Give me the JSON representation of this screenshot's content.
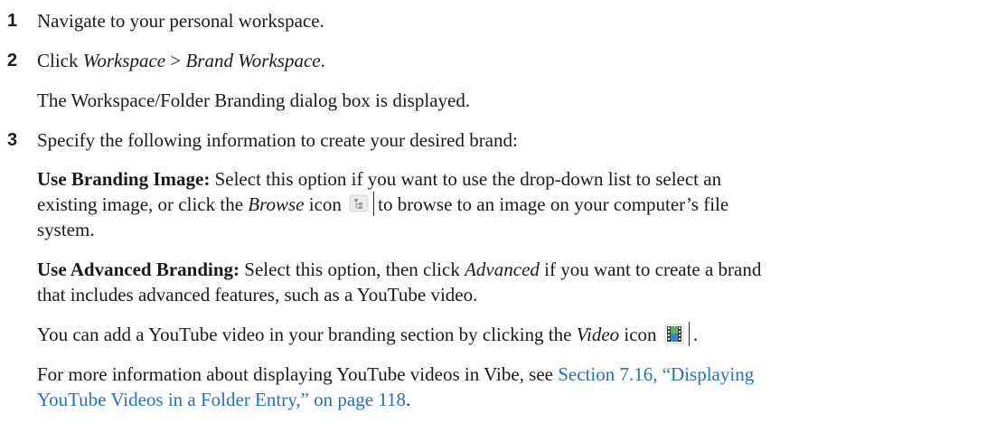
{
  "steps": [
    {
      "num": "1",
      "text": "Navigate to your personal workspace."
    },
    {
      "num": "2",
      "pre": "Click ",
      "menu1": "Workspace",
      "sep": " > ",
      "menu2": "Brand Workspace",
      "post": "."
    },
    {
      "num": "3",
      "text": "Specify the following information to create your desired brand:"
    }
  ],
  "step2_result": "The Workspace/Folder Branding dialog box is displayed.",
  "branding_image": {
    "label": "Use Branding Image:",
    "line1_rest": " Select this option if you want to use the drop-down list to select an",
    "line2_pre": "existing image, or click the ",
    "browse": "Browse",
    "line2_icon_word": " icon ",
    "line2_post": "to browse to an image on your computer’s file",
    "line3": "system.",
    "icon": "browse-tree-icon"
  },
  "advanced_branding": {
    "label": "Use Advanced Branding:",
    "line1_rest": " Select this option, then click ",
    "advanced": "Advanced",
    "line1_post": " if you want to create a brand",
    "line2": "that includes advanced features, such as a YouTube video."
  },
  "video_para": {
    "pre": "You can add a YouTube video in your branding section by clicking the ",
    "video": "Video",
    "post": " icon ",
    "end": ".",
    "icon": "video-film-icon"
  },
  "more_info": {
    "pre": "For more information about displaying YouTube videos in Vibe, see ",
    "link_line1": "Section 7.16, “Displaying",
    "link_line2": "YouTube Videos in a Folder Entry,” on page 118",
    "end": "."
  },
  "colors": {
    "link": "#1f6fd1",
    "text": "#1a1a1a"
  }
}
